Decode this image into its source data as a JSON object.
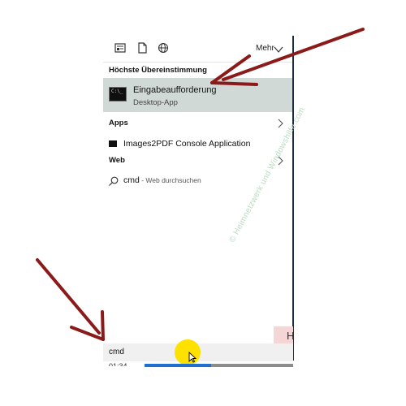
{
  "toolbar": {
    "icons": [
      "document-view-icon",
      "file-icon",
      "globe-icon"
    ],
    "more_label": "Mehr"
  },
  "best_match": {
    "header": "Höchste Übereinstimmung",
    "title": "Eingabeaufforderung",
    "subtitle": "Desktop-App"
  },
  "apps": {
    "header": "Apps",
    "items": [
      {
        "label": "Images2PDF Console Application"
      }
    ]
  },
  "web": {
    "header": "Web",
    "query": "cmd",
    "hint": " - Web durchsuchen"
  },
  "watermark": "© Heimnetzwerk und Windowshilfe.com",
  "side_letter": "H",
  "search": {
    "value": "cmd"
  },
  "taskbar": {
    "time": "01:34"
  },
  "colors": {
    "arrow": "#8b1a1a",
    "highlight": "#d1d9d6",
    "cursor_marker": "#ffe100",
    "progress": "#1e6fd0"
  }
}
